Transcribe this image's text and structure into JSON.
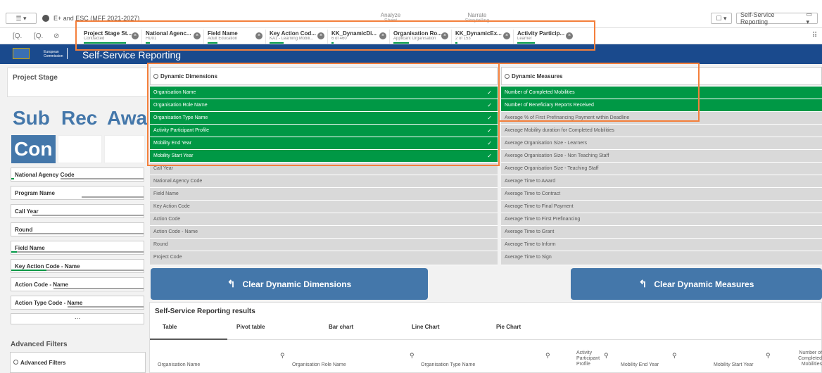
{
  "app": {
    "name": "E+ and ESC (MFF 2021-2027)"
  },
  "nav": {
    "analyze": "Analyze",
    "analyze_sub": "Sheet",
    "narrate": "Narrate",
    "narrate_sub": "Storytelling",
    "bookmark": "☐ ▾",
    "sheet_selector": "Self-Service Reporting",
    "menu": "☰ ▾"
  },
  "selections": [
    {
      "title": "Project Stage St...",
      "sub": "Contracted"
    },
    {
      "title": "National Agenc...",
      "sub": "HU01"
    },
    {
      "title": "Field Name",
      "sub": "Adult Education"
    },
    {
      "title": "Key Action Cod...",
      "sub": "KA1 - Learning Mobili..."
    },
    {
      "title": "KK_DynamicDi...",
      "sub": "6 of 460"
    },
    {
      "title": "Organisation Ro...",
      "sub": "Applicant Organisation"
    },
    {
      "title": "KK_DynamicEx...",
      "sub": "2 of 153"
    },
    {
      "title": "Activity Particip...",
      "sub": "Learner"
    }
  ],
  "header": {
    "title": "Self-Service Reporting",
    "logo_line1": "European",
    "logo_line2": "Commission"
  },
  "project_stage": {
    "title": "Project Stage",
    "tiles": [
      "Sub",
      "Rec",
      "Awa",
      "Con"
    ]
  },
  "filters": [
    "National Agency Code",
    "Program Name",
    "Call Year",
    "Round",
    "Field Name",
    "Key Action Code - Name",
    "Action Code - Name",
    "Action Type Code - Name"
  ],
  "more": "...",
  "advanced": {
    "title": "Advanced Filters",
    "search": "Advanced Filters"
  },
  "dimensions": {
    "placeholder": "Dynamic Dimensions",
    "selected": [
      "Organisation Name",
      "Organisation Role Name",
      "Organisation Type Name",
      "Activity Participant Profile",
      "Mobility End Year",
      "Mobility Start Year"
    ],
    "others": [
      "Call Year",
      "National Agency Code",
      "Field Name",
      "Key Action Code",
      "Action Code",
      "Action Code - Name",
      "Round",
      "Project Code"
    ]
  },
  "measures": {
    "placeholder": "Dynamic Measures",
    "selected": [
      "Number of Completed Mobilities",
      "Number of Beneficiary Reports Received"
    ],
    "others": [
      "Average % of First Prefinancing Payment within Deadline",
      "Average Mobility duration for Completed Mobilities",
      "Average Organisation Size - Learners",
      "Average Organisation Size - Non Teaching Staff",
      "Average Organisation Size - Teaching Staff",
      "Average Time to Award",
      "Average Time to Contract",
      "Average Time to Final Payment",
      "Average Time to First Prefinancing",
      "Average Time to Grant",
      "Average Time to Inform",
      "Average Time to Sign"
    ]
  },
  "buttons": {
    "clear_dimensions": "Clear Dynamic Dimensions",
    "clear_measures": "Clear Dynamic Measures"
  },
  "results": {
    "title": "Self-Service Reporting results",
    "tabs": [
      "Table",
      "Pivot table",
      "Bar chart",
      "Line Chart",
      "Pie Chart"
    ],
    "columns": [
      "Organisation Name",
      "Organisation Role Name",
      "Organisation Type Name",
      "Activity Participant Profile",
      "Mobility End Year",
      "Mobility Start Year",
      "Number of Completed Mobilities"
    ]
  },
  "colors": {
    "selected": "#009845",
    "brand": "#1a4a8d",
    "tile": "#4477aa",
    "highlight": "#f47f3b"
  }
}
